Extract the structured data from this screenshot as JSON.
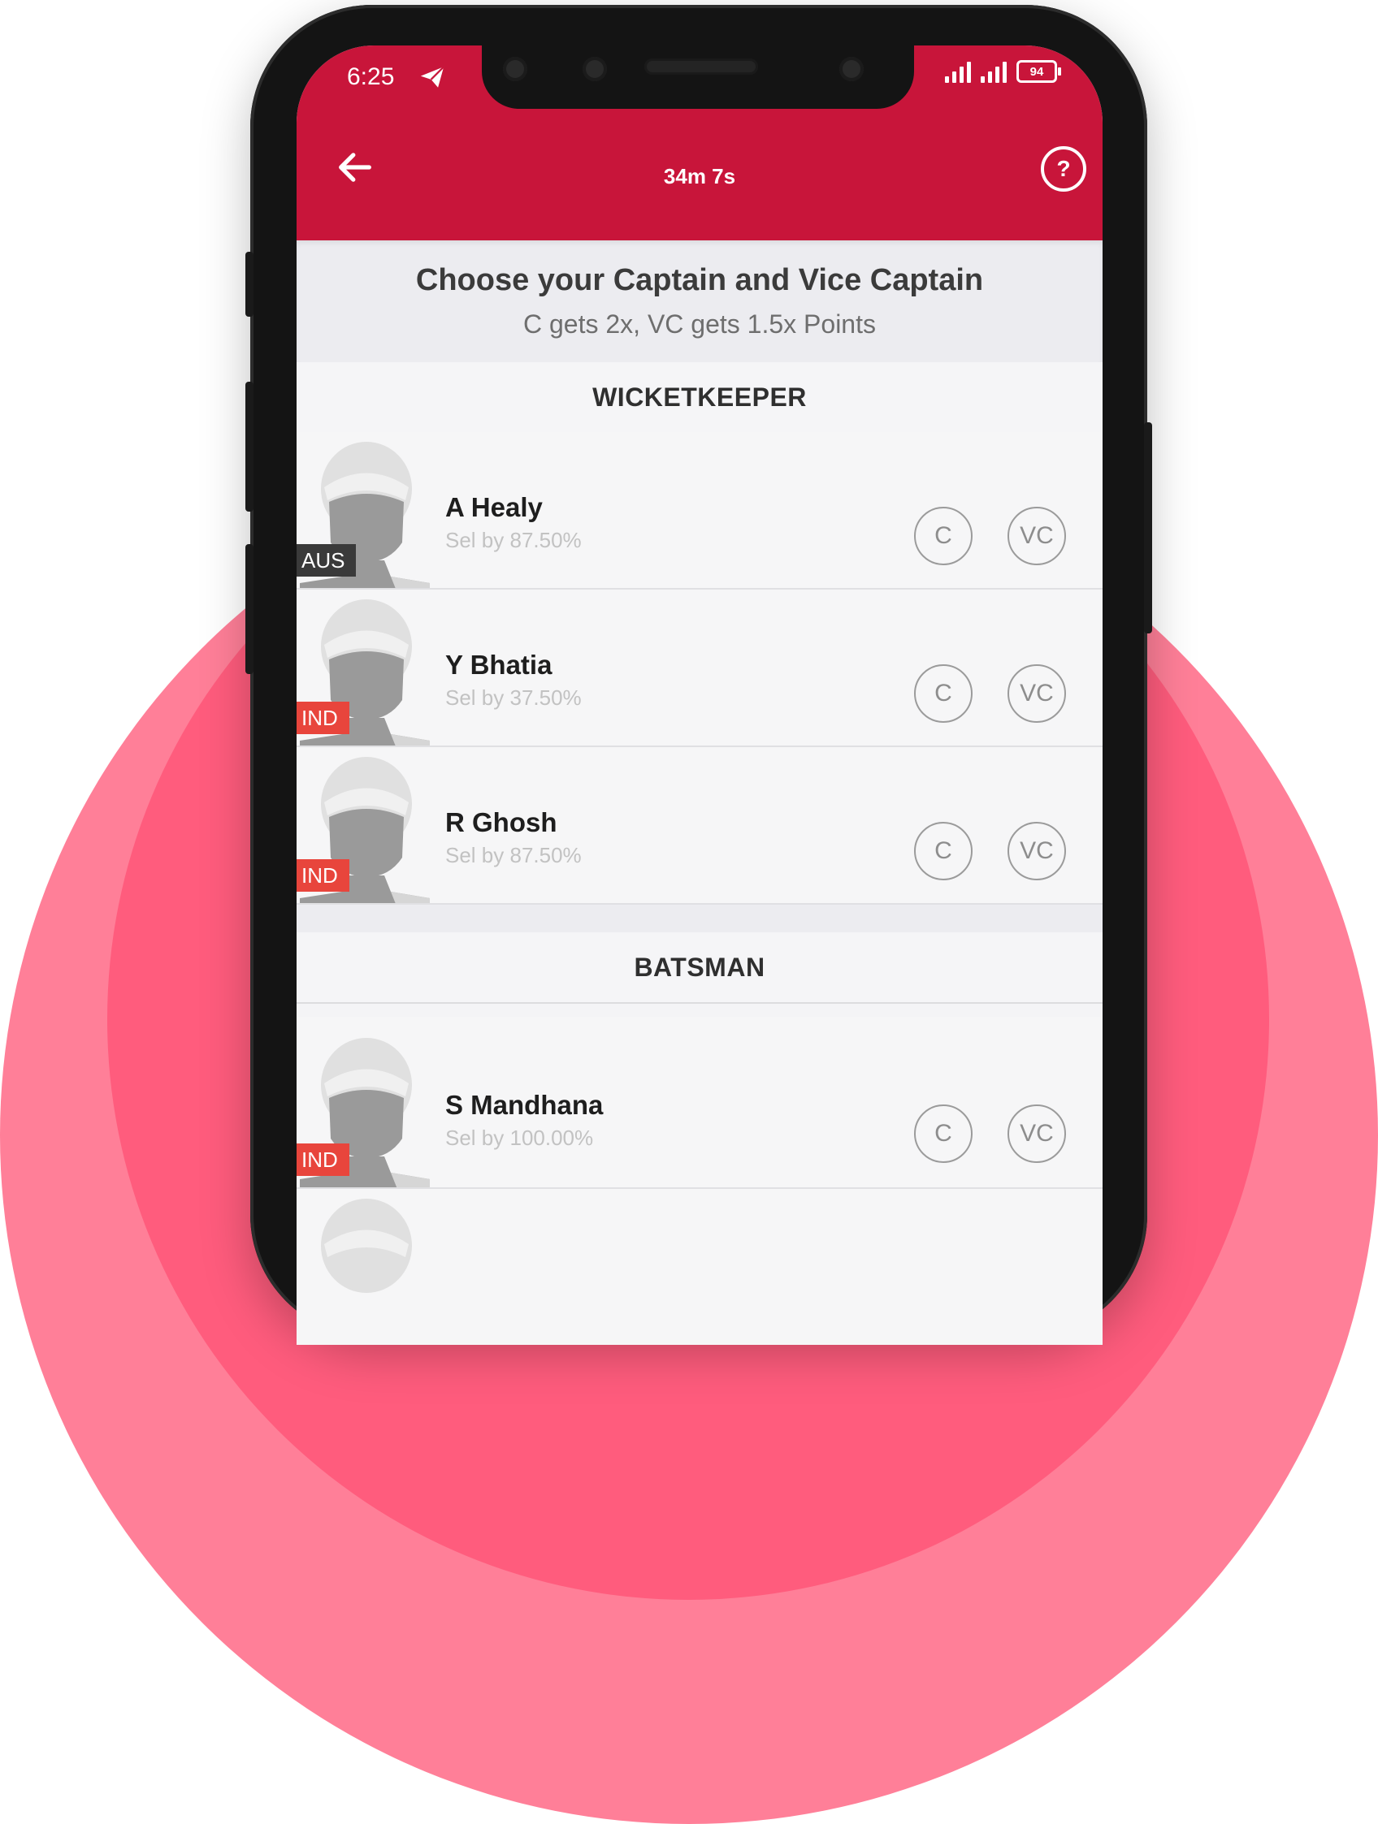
{
  "status_bar": {
    "time": "6:25",
    "battery": "94"
  },
  "header": {
    "timer": "34m 7s",
    "help_symbol": "?",
    "accent_color": "#c8153a"
  },
  "intro": {
    "title": "Choose your Captain and Vice Captain",
    "subtitle": "C gets 2x, VC gets 1.5x Points"
  },
  "sections": [
    {
      "title": "WICKETKEEPER",
      "players": [
        {
          "name": "A Healy",
          "selected_by": "Sel by 87.50%",
          "team": "AUS"
        },
        {
          "name": "Y Bhatia",
          "selected_by": "Sel by 37.50%",
          "team": "IND"
        },
        {
          "name": "R Ghosh",
          "selected_by": "Sel by 87.50%",
          "team": "IND"
        }
      ]
    },
    {
      "title": "BATSMAN",
      "players": [
        {
          "name": "S Mandhana",
          "selected_by": "Sel by 100.00%",
          "team": "IND"
        }
      ]
    }
  ],
  "buttons": {
    "captain_label": "C",
    "vice_captain_label": "VC"
  }
}
